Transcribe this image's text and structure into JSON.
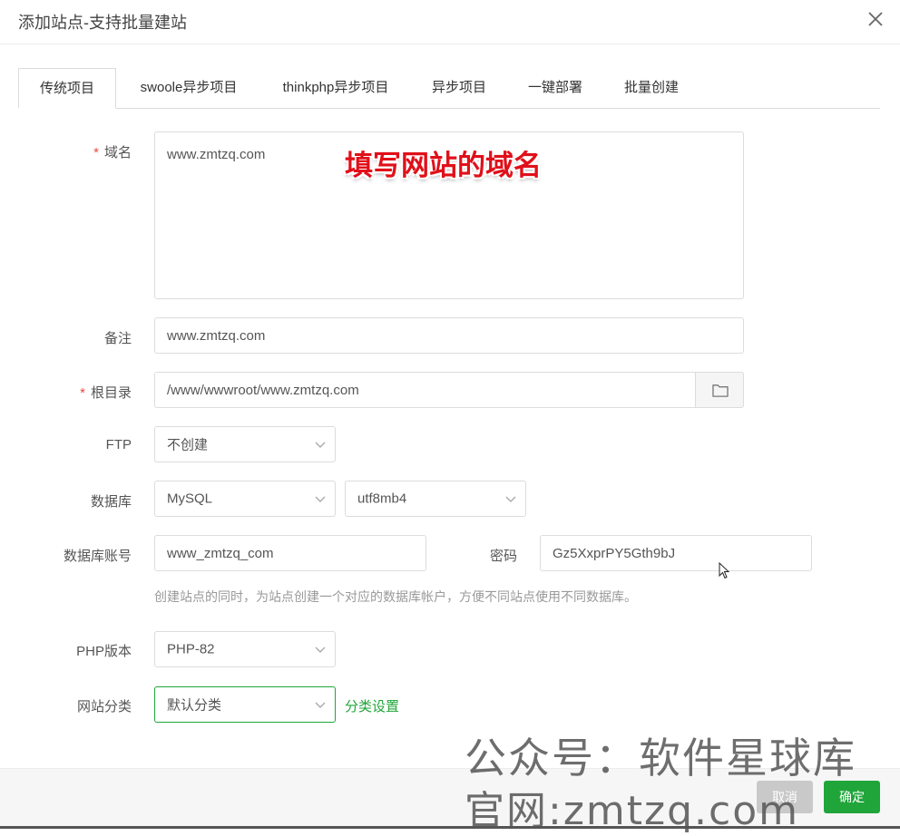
{
  "dialog": {
    "title": "添加站点-支持批量建站"
  },
  "tabs": [
    {
      "label": "传统项目",
      "active": true
    },
    {
      "label": "swoole异步项目",
      "active": false
    },
    {
      "label": "thinkphp异步项目",
      "active": false
    },
    {
      "label": "异步项目",
      "active": false
    },
    {
      "label": "一键部署",
      "active": false
    },
    {
      "label": "批量创建",
      "active": false
    }
  ],
  "form": {
    "required_mark": "*",
    "domain": {
      "label": "域名",
      "value": "www.zmtzq.com"
    },
    "remark": {
      "label": "备注",
      "value": "www.zmtzq.com"
    },
    "root": {
      "label": "根目录",
      "value": "/www/wwwroot/www.zmtzq.com"
    },
    "ftp": {
      "label": "FTP",
      "value": "不创建"
    },
    "database": {
      "label": "数据库",
      "type": "MySQL",
      "charset": "utf8mb4"
    },
    "db_account": {
      "label": "数据库账号",
      "value": "www_zmtzq_com"
    },
    "password": {
      "label": "密码",
      "value": "Gz5XxprPY5Gth9bJ"
    },
    "db_hint": "创建站点的同时，为站点创建一个对应的数据库帐户，方便不同站点使用不同数据库。",
    "php": {
      "label": "PHP版本",
      "value": "PHP-82"
    },
    "category": {
      "label": "网站分类",
      "value": "默认分类",
      "link": "分类设置"
    }
  },
  "annotation": "填写网站的域名",
  "footer": {
    "cancel": "取消",
    "confirm": "确定"
  },
  "watermark": {
    "line1": "公众号：软件星球库",
    "line2": "官网:zmtzq.com"
  },
  "colors": {
    "accent": "#20a53a",
    "required": "#e74c3c",
    "annotation": "#e0101a"
  }
}
